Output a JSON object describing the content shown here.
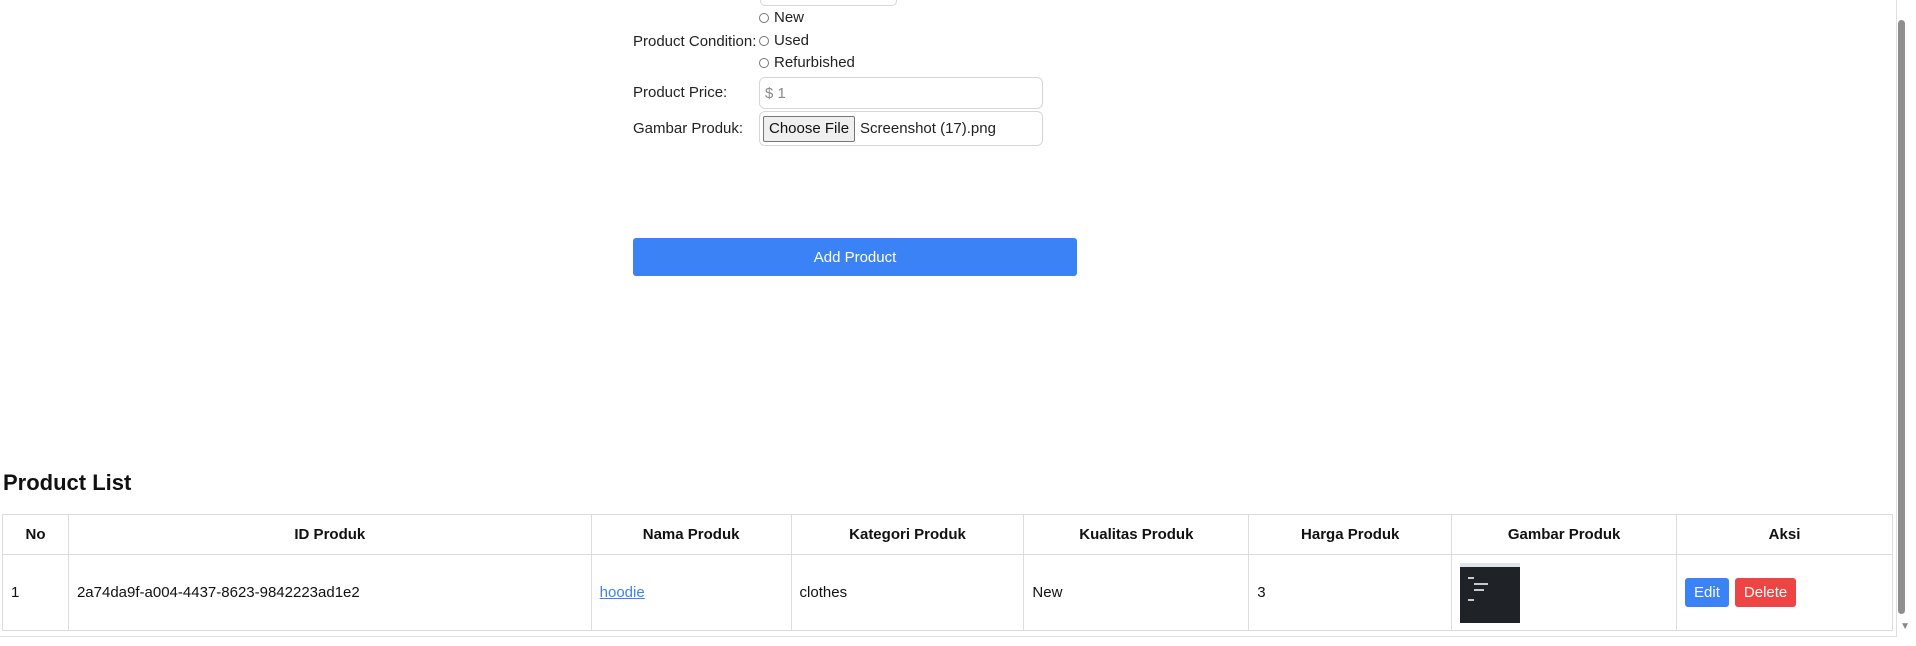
{
  "form": {
    "condition_label": "Product Condition:",
    "condition_options": [
      "New",
      "Used",
      "Refurbished"
    ],
    "price_label": "Product Price:",
    "price_value": "$ 1",
    "image_label": "Gambar Produk:",
    "file_button": "Choose File",
    "file_name": "Screenshot (17).png",
    "submit_label": "Add Product"
  },
  "product_list": {
    "title": "Product List",
    "headers": [
      "No",
      "ID Produk",
      "Nama Produk",
      "Kategori Produk",
      "Kualitas Produk",
      "Harga Produk",
      "Gambar Produk",
      "Aksi"
    ],
    "rows": [
      {
        "no": "1",
        "id": "2a74da9f-a004-4437-8623-9842223ad1e2",
        "name": "hoodie",
        "category": "clothes",
        "quality": "New",
        "price": "3",
        "edit_label": "Edit",
        "delete_label": "Delete"
      }
    ]
  },
  "colors": {
    "primary": "#3b82f6",
    "danger": "#ef4444"
  }
}
